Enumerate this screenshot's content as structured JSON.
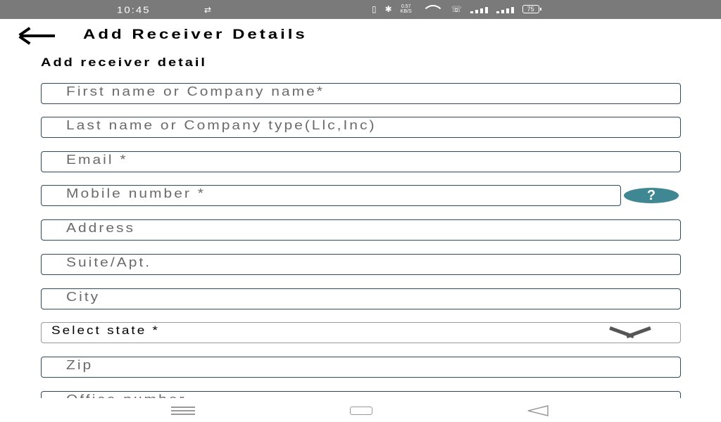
{
  "status_bar": {
    "time": "10:45",
    "network_speed_value": "0.57",
    "network_speed_unit": "KB/S",
    "battery": "75"
  },
  "header": {
    "title": "Add Receiver Details"
  },
  "section": {
    "title": "Add receiver detail"
  },
  "form": {
    "first_name_placeholder": "First name or Company name*",
    "last_name_placeholder": "Last name or Company type(Llc,Inc)",
    "email_placeholder": "Email *",
    "mobile_placeholder": "Mobile number *",
    "help_label": "?",
    "address_placeholder": "Address",
    "suite_placeholder": "Suite/Apt.",
    "city_placeholder": "City",
    "state_selected": "Select state *",
    "zip_placeholder": "Zip",
    "office_placeholder": "Office number"
  },
  "icons": {
    "back": "back-arrow-icon",
    "help": "question-icon",
    "chevron": "chevron-down-icon"
  },
  "colors": {
    "status_bar": "#7a7a7a",
    "help_button": "#3f8893",
    "field_border": "#2c4a5a"
  }
}
